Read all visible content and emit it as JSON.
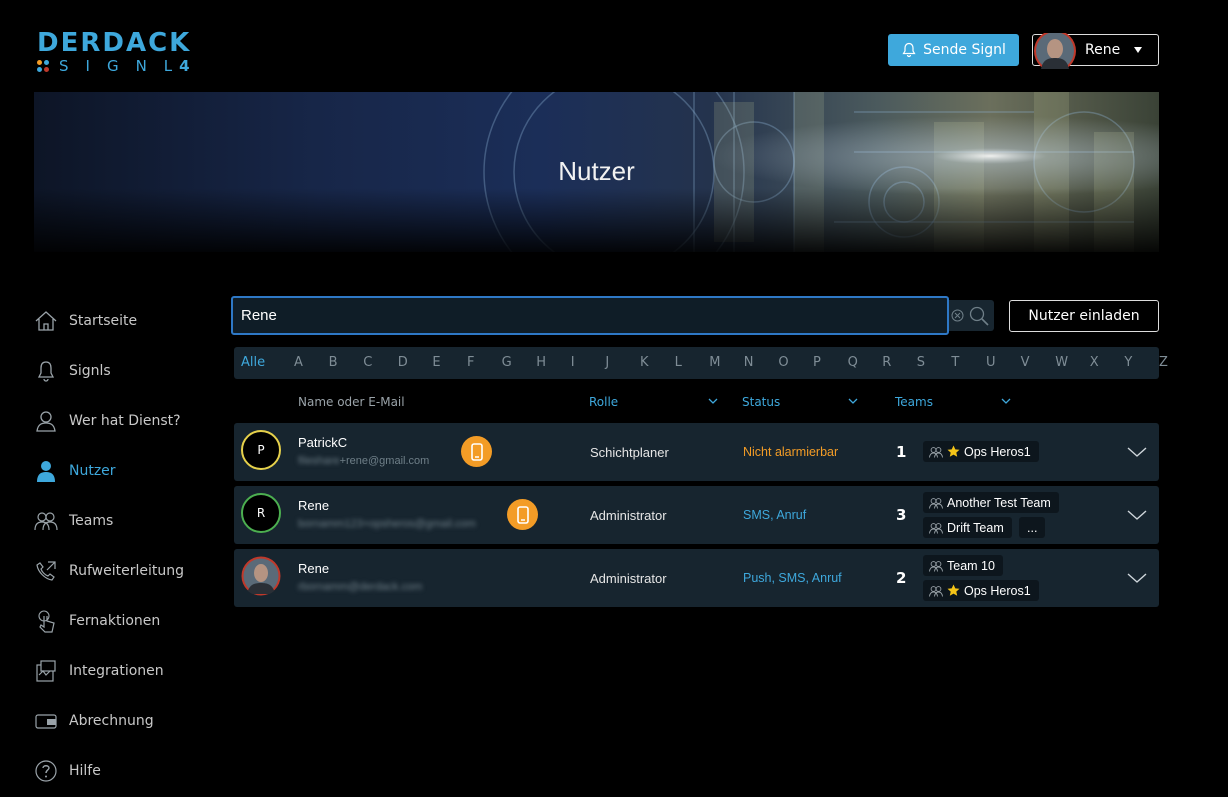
{
  "logo": {
    "top": "DERDACK",
    "bottom": "SIGNL",
    "number": "4"
  },
  "header": {
    "send_button": "Sende Signl",
    "user_name": "Rene"
  },
  "banner": {
    "title": "Nutzer"
  },
  "sidebar": {
    "items": [
      {
        "label": "Startseite",
        "icon": "home-icon"
      },
      {
        "label": "Signls",
        "icon": "bell-icon"
      },
      {
        "label": "Wer hat Dienst?",
        "icon": "on-duty-icon"
      },
      {
        "label": "Nutzer",
        "icon": "user-icon",
        "active": true
      },
      {
        "label": "Teams",
        "icon": "teams-icon"
      },
      {
        "label": "Rufweiterleitung",
        "icon": "phone-forward-icon"
      },
      {
        "label": "Fernaktionen",
        "icon": "touch-icon"
      },
      {
        "label": "Integrationen",
        "icon": "integrations-icon"
      },
      {
        "label": "Abrechnung",
        "icon": "wallet-icon"
      },
      {
        "label": "Hilfe",
        "icon": "help-icon"
      }
    ]
  },
  "search": {
    "value": "Rene",
    "placeholder": ""
  },
  "invite_button": "Nutzer einladen",
  "alphabet": [
    "Alle",
    "A",
    "B",
    "C",
    "D",
    "E",
    "F",
    "G",
    "H",
    "I",
    "J",
    "K",
    "L",
    "M",
    "N",
    "O",
    "P",
    "Q",
    "R",
    "S",
    "T",
    "U",
    "V",
    "W",
    "X",
    "Y",
    "Z"
  ],
  "columns": {
    "name": "Name oder E-Mail",
    "role": "Rolle",
    "status": "Status",
    "teams": "Teams"
  },
  "users": [
    {
      "initial": "P",
      "name": "PatrickC",
      "email_visible": "+rene@gmail.com",
      "email_blurred": "fileshare",
      "role": "Schichtplaner",
      "status": "Nicht alarmierbar",
      "team_count": "1",
      "teams": [
        {
          "name": "Ops Heros1",
          "star": true
        }
      ]
    },
    {
      "initial": "R",
      "name": "Rene",
      "email_visible": "",
      "email_blurred": "bornamm123+opsheros@gmail.com",
      "role": "Administrator",
      "status": "SMS, Anruf",
      "team_count": "3",
      "teams": [
        {
          "name": "Another Test Team",
          "star": false
        },
        {
          "name": "Drift Team",
          "star": false
        }
      ],
      "more": "..."
    },
    {
      "initial": "",
      "name": "Rene",
      "email_visible": "",
      "email_blurred": "rbornamm@derdack.com",
      "role": "Administrator",
      "status": "Push, SMS, Anruf",
      "team_count": "2",
      "teams": [
        {
          "name": "Team 10",
          "star": false
        },
        {
          "name": "Ops Heros1",
          "star": true
        }
      ]
    }
  ],
  "colors": {
    "accent": "#3ea8dc",
    "warning": "#f39c26",
    "row_bg": "#17252f"
  }
}
